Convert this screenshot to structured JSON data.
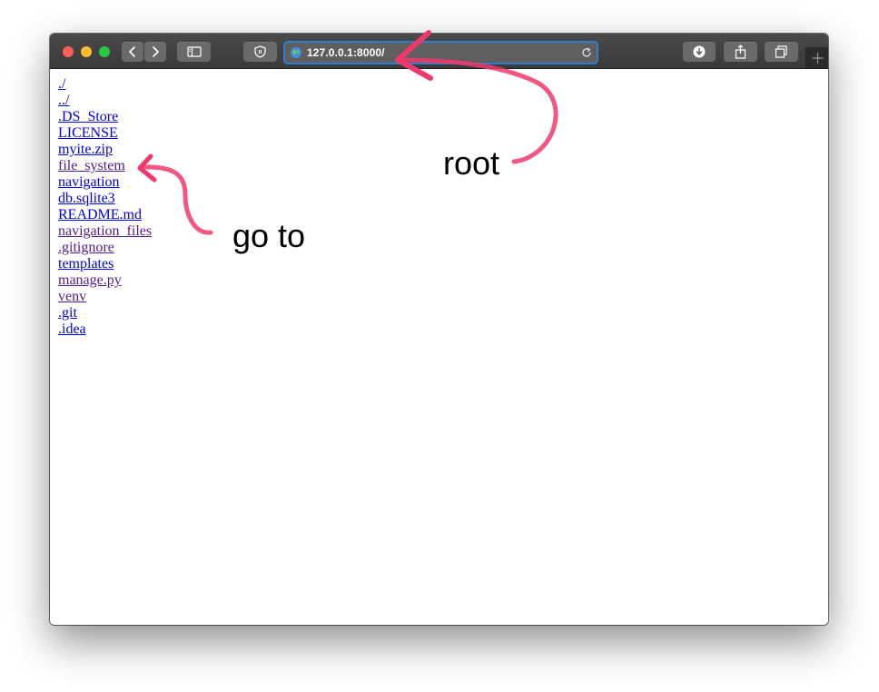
{
  "browser": {
    "url": "127.0.0.1:8000/",
    "icons": {
      "back": "chevron-left-icon",
      "forward": "chevron-right-icon",
      "sidebar": "sidebar-icon",
      "privacy": "shield-icon",
      "site": "globe-icon",
      "reload": "reload-icon",
      "downloads": "download-icon",
      "share": "share-icon",
      "tabs": "tabs-icon",
      "new_tab": "plus-icon"
    }
  },
  "listing": {
    "items": [
      {
        "label": "./",
        "visited": false
      },
      {
        "label": "../",
        "visited": false
      },
      {
        "label": ".DS_Store",
        "visited": false
      },
      {
        "label": "LICENSE",
        "visited": false
      },
      {
        "label": "myite.zip",
        "visited": false
      },
      {
        "label": "file_system",
        "visited": true
      },
      {
        "label": "navigation",
        "visited": false
      },
      {
        "label": "db.sqlite3",
        "visited": false
      },
      {
        "label": "README.md",
        "visited": false
      },
      {
        "label": "navigation_files",
        "visited": true
      },
      {
        "label": ".gitignore",
        "visited": true
      },
      {
        "label": "templates",
        "visited": false
      },
      {
        "label": "manage.py",
        "visited": true
      },
      {
        "label": "venv",
        "visited": true
      },
      {
        "label": ".git",
        "visited": false
      },
      {
        "label": ".idea",
        "visited": false
      }
    ]
  },
  "annotations": {
    "root_label": "root",
    "goto_label": "go to",
    "arrow_color": "#f0386b"
  }
}
